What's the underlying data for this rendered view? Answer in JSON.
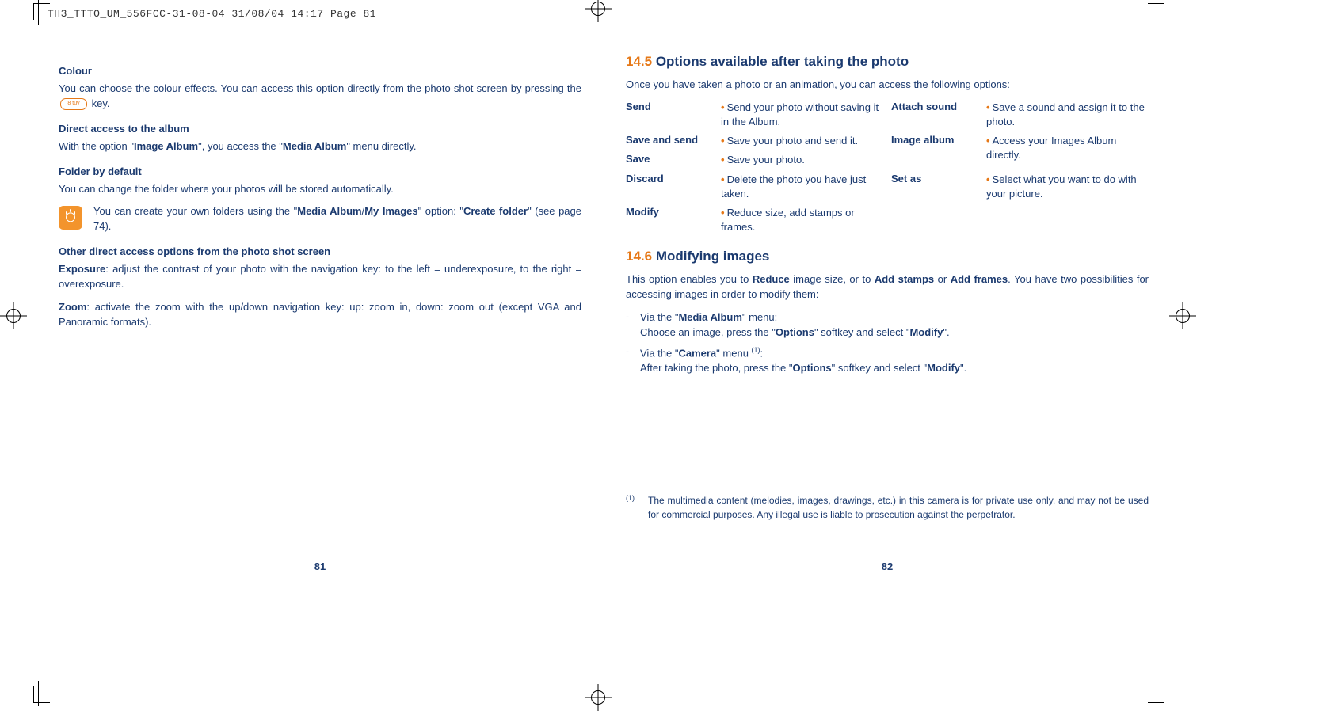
{
  "header": "TH3_TTTO_UM_556FCC-31-08-04  31/08/04  14:17  Page 81",
  "left": {
    "h_colour": "Colour",
    "p_colour_a": "You can choose the colour effects. You can access this option directly from the photo shot screen by pressing the ",
    "p_colour_b": " key.",
    "key_label": "8 tuv",
    "h_direct": "Direct access to the album",
    "p_direct_a": "With the option \"",
    "p_direct_bold1": "Image Album",
    "p_direct_b": "\", you access the \"",
    "p_direct_bold2": "Media Album",
    "p_direct_c": "\" menu directly.",
    "h_folder": "Folder by default",
    "p_folder": "You can change the folder where your photos will be stored automatically.",
    "tip_a": "You can create your own folders using the \"",
    "tip_bold1": "Media Album",
    "tip_slash": "/",
    "tip_bold2": "My Images",
    "tip_b": "\" option: \"",
    "tip_bold3": "Create folder",
    "tip_c": "\" (see page 74).",
    "h_other": "Other direct access options from the photo shot screen",
    "exposure_bold": "Exposure",
    "exposure_text": ": adjust the contrast of your photo with the navigation key: to the left = underexposure, to the right = overexposure.",
    "zoom_bold": "Zoom",
    "zoom_text": ": activate the zoom with the up/down navigation key: up: zoom in, down: zoom out (except VGA and Panoramic formats).",
    "pagenum": "81"
  },
  "right": {
    "sec145_num": "14.5",
    "sec145_a": " Options available ",
    "sec145_u": "after",
    "sec145_b": " taking the photo",
    "intro145": "Once you have taken a photo or an animation, you can access the following options:",
    "opts": [
      {
        "label": "Send",
        "desc": "Send your photo without saving it in the Album."
      },
      {
        "label": "Save and send",
        "desc": "Save your photo and send it."
      },
      {
        "label": "Save",
        "desc": "Save your photo."
      },
      {
        "label": "Discard",
        "desc": "Delete the photo you have just taken."
      },
      {
        "label": "Modify",
        "desc": "Reduce size, add stamps or frames."
      },
      {
        "label": "Attach sound",
        "desc": "Save a sound and assign it to the photo."
      },
      {
        "label": "Image album",
        "desc": "Access your Images Album directly."
      },
      {
        "label": "Set as",
        "desc": "Select what you want to do with your picture."
      }
    ],
    "sec146_num": "14.6",
    "sec146_ttl": " Modifying images",
    "p146_a": "This option enables you to ",
    "p146_b1": "Reduce",
    "p146_b": " image size, or to ",
    "p146_b2": "Add stamps",
    "p146_c": " or ",
    "p146_b3": "Add frames",
    "p146_d": ". You have two possibilities for accessing images in order to modify them:",
    "li1_a": "Via the \"",
    "li1_bold": "Media Album",
    "li1_b": "\" menu:",
    "li1_line2a": "Choose an image, press the \"",
    "li1_line2bold": "Options",
    "li1_line2b": "\" softkey and select \"",
    "li1_line2bold2": "Modify",
    "li1_line2c": "\".",
    "li2_a": "Via the \"",
    "li2_bold": "Camera",
    "li2_b": "\" menu ",
    "li2_sup": "(1)",
    "li2_c": ":",
    "li2_line2a": "After taking the photo, press the \"",
    "li2_line2bold": "Options",
    "li2_line2b": "\" softkey and select \"",
    "li2_line2bold2": "Modify",
    "li2_line2c": "\".",
    "fn_mark": "(1)",
    "fn_text": "The multimedia content (melodies, images, drawings, etc.) in this camera is for private use only, and may not be used for commercial purposes. Any illegal use is liable to prosecution against the perpetrator.",
    "pagenum": "82"
  }
}
